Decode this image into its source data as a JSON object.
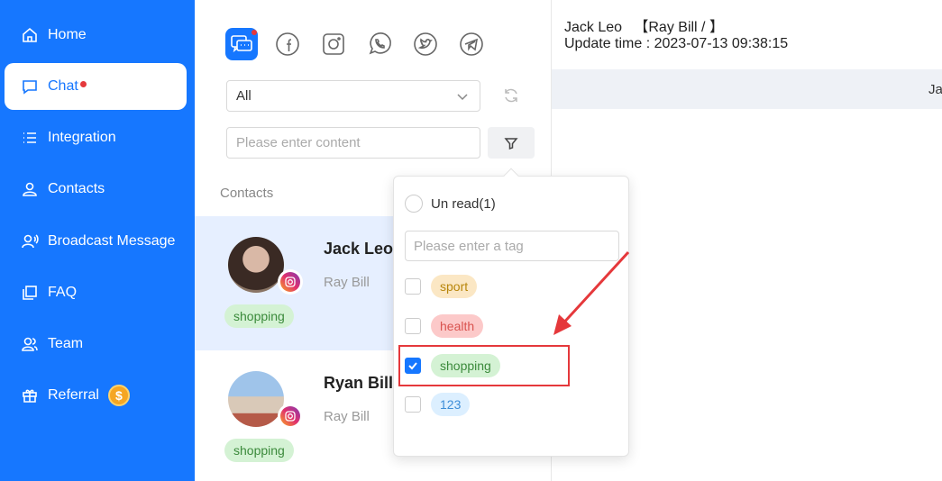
{
  "sidebar": {
    "items": [
      {
        "label": "Home",
        "icon": "home-icon"
      },
      {
        "label": "Chat",
        "icon": "chat-icon",
        "active": true,
        "badge_dot": true
      },
      {
        "label": "Integration",
        "icon": "list-icon"
      },
      {
        "label": "Contacts",
        "icon": "user-icon"
      },
      {
        "label": "Broadcast Message",
        "icon": "broadcast-icon"
      },
      {
        "label": "FAQ",
        "icon": "faq-icon"
      },
      {
        "label": "Team",
        "icon": "team-icon"
      },
      {
        "label": "Referral",
        "icon": "gift-icon",
        "coin": "$"
      }
    ]
  },
  "platforms": [
    "all-messages",
    "facebook",
    "instagram",
    "whatsapp",
    "twitter",
    "telegram"
  ],
  "filter": {
    "select_value": "All",
    "search_placeholder": "Please enter content"
  },
  "contacts_label": "Contacts",
  "contacts": [
    {
      "name": "Jack Leo",
      "sub": "Ray Bill",
      "tag": "shopping",
      "platform": "instagram",
      "selected": true
    },
    {
      "name": "Ryan Bill",
      "sub": "Ray Bill",
      "tag": "shopping",
      "platform": "instagram",
      "selected": false
    }
  ],
  "popover": {
    "unread_label": "Un read(1)",
    "tag_placeholder": "Please enter a tag",
    "tags": [
      {
        "label": "sport",
        "checked": false,
        "bg": "#fbe7c4",
        "fg": "#b8860b"
      },
      {
        "label": "health",
        "checked": false,
        "bg": "#fcc9c9",
        "fg": "#d9534f"
      },
      {
        "label": "shopping",
        "checked": true,
        "bg": "#d4f2d4",
        "fg": "#3b8a3b"
      },
      {
        "label": "123",
        "checked": false,
        "bg": "#dcefff",
        "fg": "#3d8ed8"
      }
    ]
  },
  "detail": {
    "header_line": "Jack Leo   【Ray Bill / 】",
    "update_line": "Update time : 2023-07-13 09:38:15",
    "bar_text": "Ja"
  },
  "colors": {
    "primary": "#1677ff",
    "highlight": "#e5383b"
  }
}
